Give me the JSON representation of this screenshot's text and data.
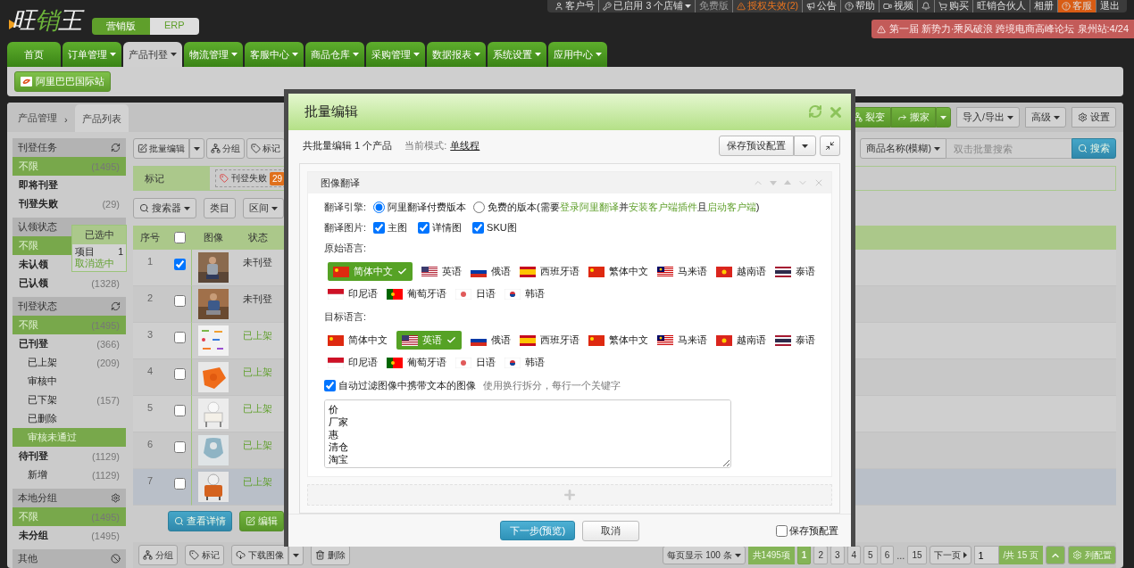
{
  "header": {
    "logo": "旺销王",
    "editions": [
      {
        "label": "营销版",
        "selected": true
      },
      {
        "label": "ERP",
        "selected": false
      }
    ],
    "top_menu": [
      {
        "kind": "user",
        "label": "客户号"
      },
      {
        "kind": "key",
        "label": "已启用 3 个店铺",
        "dropdown": true
      },
      {
        "kind": "muted",
        "label": "免费版"
      },
      {
        "kind": "warning",
        "label": "授权失效(2)"
      },
      {
        "kind": "megaphone",
        "label": "公告"
      },
      {
        "kind": "help",
        "label": "帮助"
      },
      {
        "kind": "video",
        "label": "视频"
      },
      {
        "kind": "bell"
      },
      {
        "kind": "cart",
        "label": "购买"
      },
      {
        "kind": "plain",
        "label": "旺销合伙人"
      },
      {
        "kind": "plain",
        "label": "相册"
      },
      {
        "kind": "service",
        "label": "客服"
      },
      {
        "kind": "plain",
        "label": "退出"
      }
    ],
    "banner": "第一届 新势力·乘风破浪 跨境电商高峰论坛 泉州站:4/24"
  },
  "nav": [
    {
      "label": "首页",
      "selected": false,
      "dropdown": false
    },
    {
      "label": "订单管理",
      "selected": false,
      "dropdown": true
    },
    {
      "label": "产品刊登",
      "selected": true,
      "dropdown": true
    },
    {
      "label": "物流管理",
      "selected": false,
      "dropdown": true
    },
    {
      "label": "客服中心",
      "selected": false,
      "dropdown": true
    },
    {
      "label": "商品仓库",
      "selected": false,
      "dropdown": true
    },
    {
      "label": "采购管理",
      "selected": false,
      "dropdown": true
    },
    {
      "label": "数据报表",
      "selected": false,
      "dropdown": true
    },
    {
      "label": "系统设置",
      "selected": false,
      "dropdown": true
    },
    {
      "label": "应用中心",
      "selected": false,
      "dropdown": true
    }
  ],
  "platform_button": "阿里巴巴国际站",
  "breadcrumb": {
    "parent": "产品管理",
    "separator": "›",
    "tab": "产品列表"
  },
  "toolbar_right": [
    {
      "label": "裂变",
      "kind": "group",
      "split": false,
      "dropdown": false
    },
    {
      "label": "搬家",
      "kind": "share",
      "split": true,
      "dropdown": false
    },
    {
      "label": "导入/导出",
      "kind": "none",
      "split": false,
      "dropdown": true
    },
    {
      "label": "高级",
      "kind": "none",
      "split": false,
      "dropdown": true
    },
    {
      "label": "设置",
      "kind": "gear",
      "split": false,
      "dropdown": false
    }
  ],
  "sidebar": [
    {
      "title": "刊登任务",
      "kind": "refresh",
      "items": [
        {
          "label": "不限",
          "count": "(1495)",
          "selected": true
        },
        {
          "label": "即将刊登",
          "selected": false
        },
        {
          "label": "刊登失败",
          "count": "(29)",
          "selected": false
        }
      ]
    },
    {
      "title": "认领状态",
      "kind": "plain",
      "items": [
        {
          "label": "不限",
          "selected": true
        },
        {
          "label": "未认领",
          "selected": false
        },
        {
          "label": "已认领",
          "count": "(1328)",
          "selected": false
        }
      ]
    },
    {
      "title": "刊登状态",
      "kind": "refresh",
      "items": [
        {
          "label": "不限",
          "count": "(1495)",
          "selected": true
        },
        {
          "label": "已刊登",
          "count": "(366)",
          "selected": false,
          "children": [
            {
              "label": "已上架",
              "count": "(209)",
              "selected": false
            },
            {
              "label": "审核中",
              "selected": false
            },
            {
              "label": "已下架",
              "count": "(157)",
              "selected": false
            },
            {
              "label": "已删除",
              "selected": false
            },
            {
              "label": "审核未通过",
              "selected": true
            }
          ]
        },
        {
          "label": "待刊登",
          "count": "(1129)",
          "selected": false,
          "children": [
            {
              "label": "新增",
              "count": "(1129)",
              "selected": false
            }
          ]
        }
      ]
    },
    {
      "title": "本地分组",
      "kind": "gear",
      "items": [
        {
          "label": "不限",
          "count": "(1495)",
          "selected": true
        },
        {
          "label": "未分组",
          "count": "(1495)",
          "selected": false
        }
      ]
    },
    {
      "title": "其他",
      "kind": "ban"
    }
  ],
  "selection_popup": {
    "title": "已选中",
    "rows": [
      {
        "label": "项目",
        "value": "1"
      }
    ],
    "link": "取消选中"
  },
  "toolbar_left": [
    {
      "label": "批量编辑",
      "kind": "edit",
      "split": true
    },
    {
      "label": "分组",
      "kind": "group"
    },
    {
      "label": "标记",
      "kind": "tag"
    }
  ],
  "search": {
    "field": "商品名称(模糊)",
    "placeholder": "双击批量搜索",
    "button": "搜索"
  },
  "tag_filter": {
    "label": "标记",
    "tags": [
      {
        "label": "刊登失败",
        "count": "29"
      }
    ]
  },
  "filters": [
    {
      "label": "搜索器",
      "kind": "search",
      "dropdown": true
    },
    {
      "label": "类目",
      "kind": "none",
      "dropdown": false
    },
    {
      "label": "区间",
      "kind": "none",
      "dropdown": true
    }
  ],
  "table": {
    "columns": [
      "序号",
      "图像",
      "状态"
    ],
    "all_checked": false,
    "rows": [
      {
        "index": "1",
        "checked": true,
        "status": "未刊登",
        "kind": "unlisted",
        "highlighted": false
      },
      {
        "index": "2",
        "checked": false,
        "status": "未刊登",
        "kind": "unlisted",
        "highlighted": false
      },
      {
        "index": "3",
        "checked": false,
        "status": "已上架",
        "kind": "listed",
        "highlighted": false
      },
      {
        "index": "4",
        "checked": false,
        "status": "已上架",
        "kind": "listed",
        "highlighted": false
      },
      {
        "index": "5",
        "checked": false,
        "status": "已上架",
        "kind": "listed",
        "highlighted": false
      },
      {
        "index": "6",
        "checked": false,
        "status": "已上架",
        "kind": "listed",
        "highlighted": false
      },
      {
        "index": "7",
        "checked": false,
        "status": "已上架",
        "kind": "listed",
        "highlighted": true
      }
    ],
    "actions": [
      {
        "label": "查看详情",
        "kind": "view"
      },
      {
        "label": "编辑",
        "kind": "edit"
      }
    ]
  },
  "bottom_bar": {
    "buttons": [
      {
        "label": "分组",
        "kind": "group",
        "dropdown": false
      },
      {
        "label": "标记",
        "kind": "tag",
        "dropdown": false
      },
      {
        "label": "下载图像",
        "kind": "download",
        "dropdown": true
      },
      {
        "label": "删除",
        "kind": "trash",
        "dropdown": false
      }
    ],
    "per_page": "每页显示 100 条",
    "total": "共1495项",
    "pages": [
      {
        "label": "1",
        "selected": true
      },
      {
        "label": "2",
        "selected": false
      },
      {
        "label": "3",
        "selected": false
      },
      {
        "label": "4",
        "selected": false
      },
      {
        "label": "5",
        "selected": false
      },
      {
        "label": "6",
        "selected": false
      },
      {
        "label": "...",
        "kind": "ellipsis"
      },
      {
        "label": "15",
        "selected": false
      }
    ],
    "next": "下一页",
    "page_input": "1",
    "page_total": "/共 15 页",
    "columns_button": "列配置"
  },
  "modal": {
    "title": "批量编辑",
    "summary": "共批量编辑 1 个产品",
    "mode_label": "当前模式:",
    "mode": "单线程",
    "preset_button": "保存预设配置",
    "section": {
      "title": "图像翻译",
      "engine_label": "翻译引擎:",
      "engines": [
        {
          "selected": true,
          "parts": [
            {
              "text": "阿里翻译付费版本",
              "kind": "text"
            }
          ]
        },
        {
          "selected": false,
          "parts": [
            {
              "text": "免费的版本(需要",
              "kind": "text"
            },
            {
              "text": "登录阿里翻译",
              "kind": "link"
            },
            {
              "text": "并",
              "kind": "text"
            },
            {
              "text": "安装客户端插件",
              "kind": "link"
            },
            {
              "text": "且",
              "kind": "text"
            },
            {
              "text": "启动客户端",
              "kind": "link"
            },
            {
              "text": ")",
              "kind": "text"
            }
          ]
        }
      ],
      "images_label": "翻译图片:",
      "images": [
        {
          "label": "主图",
          "checked": true
        },
        {
          "label": "详情图",
          "checked": true
        },
        {
          "label": "SKU图",
          "checked": true
        }
      ],
      "source_label": "原始语言:",
      "source": [
        {
          "label": "简体中文",
          "kind": "cn",
          "selected": true
        },
        {
          "label": "英语",
          "kind": "us",
          "selected": false
        },
        {
          "label": "俄语",
          "kind": "ru",
          "selected": false
        },
        {
          "label": "西班牙语",
          "kind": "es",
          "selected": false
        },
        {
          "label": "繁体中文",
          "kind": "cn",
          "selected": false
        },
        {
          "label": "马来语",
          "kind": "my",
          "selected": false
        },
        {
          "label": "越南语",
          "kind": "vn",
          "selected": false
        },
        {
          "label": "泰语",
          "kind": "th",
          "selected": false
        },
        {
          "label": "印尼语",
          "kind": "id",
          "selected": false
        },
        {
          "label": "葡萄牙语",
          "kind": "pt",
          "selected": false
        },
        {
          "label": "日语",
          "kind": "jp",
          "selected": false
        },
        {
          "label": "韩语",
          "kind": "kr",
          "selected": false
        }
      ],
      "target_label": "目标语言:",
      "target": [
        {
          "label": "简体中文",
          "kind": "cn",
          "selected": false
        },
        {
          "label": "英语",
          "kind": "us",
          "selected": true
        },
        {
          "label": "俄语",
          "kind": "ru",
          "selected": false
        },
        {
          "label": "西班牙语",
          "kind": "es",
          "selected": false
        },
        {
          "label": "繁体中文",
          "kind": "cn",
          "selected": false
        },
        {
          "label": "马来语",
          "kind": "my",
          "selected": false
        },
        {
          "label": "越南语",
          "kind": "vn",
          "selected": false
        },
        {
          "label": "泰语",
          "kind": "th",
          "selected": false
        },
        {
          "label": "印尼语",
          "kind": "id",
          "selected": false
        },
        {
          "label": "葡萄牙语",
          "kind": "pt",
          "selected": false
        },
        {
          "label": "日语",
          "kind": "jp",
          "selected": false
        },
        {
          "label": "韩语",
          "kind": "kr",
          "selected": false
        }
      ],
      "filter": {
        "label": "自动过滤图像中携带文本的图像",
        "checked": true,
        "hint": "使用换行拆分，每行一个关键字",
        "keywords": [
          "价",
          "厂家",
          "惠",
          "清仓",
          "淘宝"
        ]
      }
    },
    "next_button": "下一步(预览)",
    "cancel_button": "取消",
    "save_preset": {
      "label": "保存预配置",
      "checked": false
    }
  }
}
